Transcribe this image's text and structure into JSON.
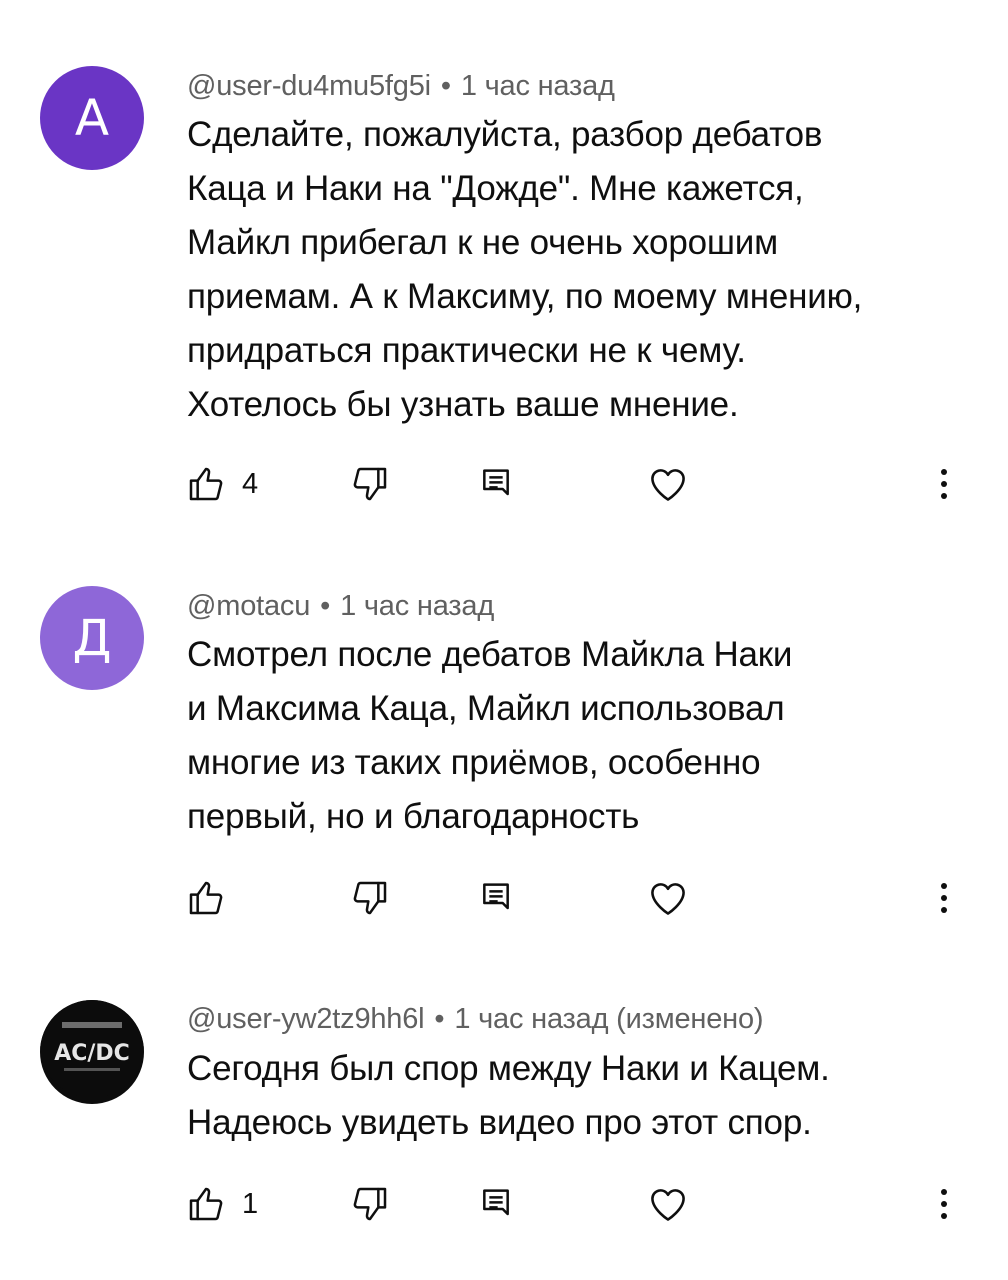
{
  "comments": [
    {
      "avatar_letter": "А",
      "avatar_color": "#6a35c5",
      "author": "@user-du4mu5fg5i",
      "separator": "•",
      "time": "1 час назад",
      "lines": [
        "Сделайте, пожалуйста, разбор дебатов",
        "Каца и Наки на \"Дожде\". Мне кажется,",
        "Майкл прибегал к не очень хорошим",
        "приемам. А к Максиму, по моему мнению,",
        "придраться практически не к чему.",
        "Хотелось бы узнать ваше мнение."
      ],
      "likes": "4"
    },
    {
      "avatar_letter": "Д",
      "avatar_color": "#8e67d8",
      "author": "@motacu",
      "separator": "•",
      "time": "1 час назад",
      "lines": [
        "Смотрел после дебатов Майкла Наки",
        "и Максима Каца, Майкл использовал",
        "многие из таких приёмов, особенно",
        "первый, но и благодарность"
      ],
      "likes": ""
    },
    {
      "avatar_image": "AC/DC logo",
      "avatar_color": "#0c0c0c",
      "author": "@user-yw2tz9hh6l",
      "separator": "•",
      "time": "1 час назад (изменено)",
      "lines": [
        "Сегодня был спор между Наки и Кацем.",
        "Надеюсь увидеть видео про этот спор."
      ],
      "likes": "1"
    }
  ],
  "icons": {
    "like": "thumb-up-icon",
    "dislike": "thumb-down-icon",
    "reply": "reply-icon",
    "heart": "heart-icon",
    "more": "more-vertical-icon"
  },
  "logo_text": "AC/DC"
}
